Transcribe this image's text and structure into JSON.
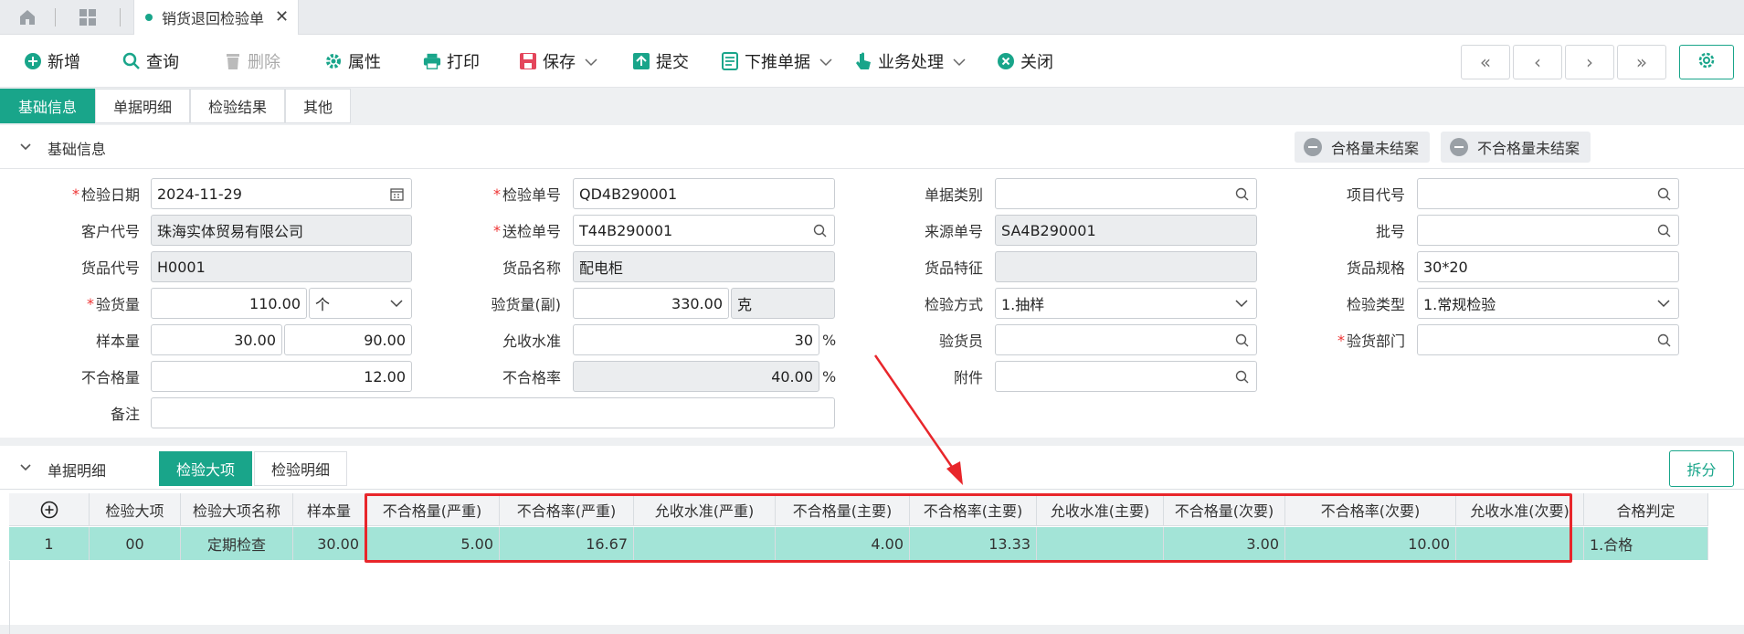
{
  "tabs": {
    "document_tab": "销货退回检验单"
  },
  "toolbar": {
    "add": "新增",
    "query": "查询",
    "delete": "删除",
    "properties": "属性",
    "print": "打印",
    "save": "保存",
    "submit": "提交",
    "push_down": "下推单据",
    "business": "业务处理",
    "close": "关闭"
  },
  "section_tabs": [
    "基础信息",
    "单据明细",
    "检验结果",
    "其他"
  ],
  "basic": {
    "title": "基础信息",
    "status1": "合格量未结案",
    "status2": "不合格量未结案",
    "labels": {
      "inspect_date": "检验日期",
      "customer_code": "客户代号",
      "goods_code": "货品代号",
      "inspect_qty": "验货量",
      "sample_qty": "样本量",
      "unqualified_qty": "不合格量",
      "remark": "备注",
      "inspect_no": "检验单号",
      "send_no": "送检单号",
      "goods_name": "货品名称",
      "inspect_qty_sub": "验货量(副)",
      "allow_level": "允收水准",
      "unqualified_rate": "不合格率",
      "doc_type": "单据类别",
      "source_no": "来源单号",
      "goods_feature": "货品特征",
      "inspect_method": "检验方式",
      "inspector": "验货员",
      "attachment": "附件",
      "project_code": "项目代号",
      "batch_no": "批号",
      "goods_spec": "货品规格",
      "inspect_type": "检验类型",
      "inspect_dept": "验货部门"
    },
    "values": {
      "inspect_date": "2024-11-29",
      "customer_code": "珠海实体贸易有限公司",
      "goods_code": "H0001",
      "inspect_qty": "110.00",
      "inspect_unit": "个",
      "sample_qty": "30.00",
      "sample_qty2": "90.00",
      "unqualified_qty": "12.00",
      "remark": "",
      "inspect_no": "QD4B290001",
      "send_no": "T44B290001",
      "goods_name": "配电柜",
      "inspect_qty_sub": "330.00",
      "sub_unit": "克",
      "allow_level": "30",
      "unqualified_rate": "40.00",
      "doc_type": "",
      "source_no": "SA4B290001",
      "goods_feature": "",
      "inspect_method": "1.抽样",
      "inspector": "",
      "attachment": "",
      "project_code": "",
      "batch_no": "",
      "goods_spec": "30*20",
      "inspect_type": "1.常规检验",
      "inspect_dept": ""
    },
    "percent": "%"
  },
  "detail": {
    "title": "单据明细",
    "tab_active": "检验大项",
    "tab_other": "检验明细",
    "split": "拆分",
    "columns": [
      "检验大项",
      "检验大项名称",
      "样本量",
      "不合格量(严重)",
      "不合格率(严重)",
      "允收水准(严重)",
      "不合格量(主要)",
      "不合格率(主要)",
      "允收水准(主要)",
      "不合格量(次要)",
      "不合格率(次要)",
      "允收水准(次要)",
      "合格判定"
    ],
    "rows": [
      {
        "no": "1",
        "cells": [
          "00",
          "定期检查",
          "30.00",
          "5.00",
          "16.67",
          "",
          "4.00",
          "13.33",
          "",
          "3.00",
          "10.00",
          "",
          "1.合格"
        ]
      }
    ]
  }
}
